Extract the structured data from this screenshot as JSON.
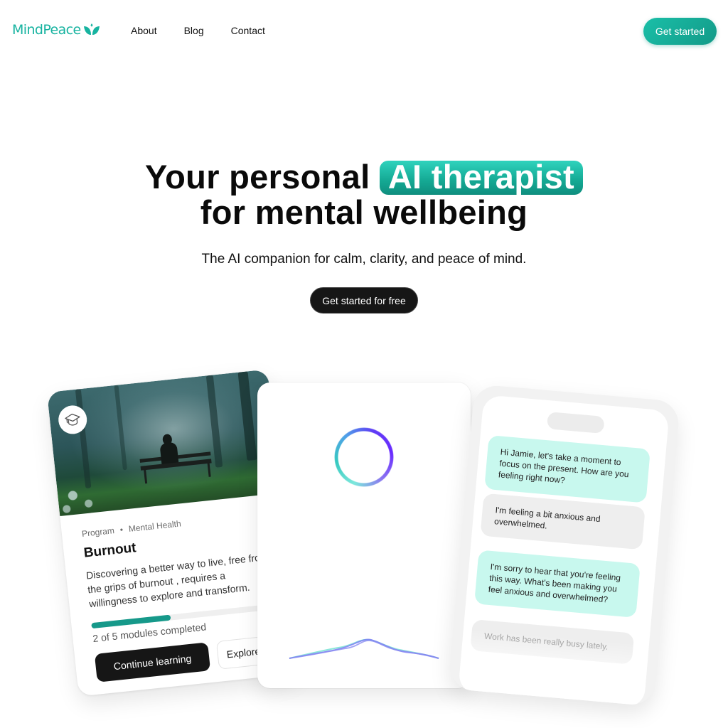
{
  "nav": {
    "logo_text": "MindPeace",
    "logo_icon": "leaf-sprout-icon",
    "links": [
      {
        "label": "About"
      },
      {
        "label": "Blog"
      },
      {
        "label": "Contact"
      }
    ],
    "cta_label": "Get started"
  },
  "hero": {
    "title_part1": "Your personal",
    "title_highlight": "AI therapist",
    "title_line2": "for mental wellbeing",
    "subtitle": "The AI companion for calm, clarity, and peace of mind.",
    "cta_label": "Get started for free"
  },
  "program_card": {
    "icon": "graduation-cap-icon",
    "type": "Program",
    "separator": "•",
    "category": "Mental Health",
    "title": "Burnout",
    "description": "Discovering a better way to live, free from the grips of burnout , requires a willingness to explore and transform.",
    "progress": {
      "completed": 2,
      "total": 5,
      "label": "2 of 5 modules completed"
    },
    "primary_button": "Continue learning",
    "secondary_button": "Explore"
  },
  "voice_card": {
    "orb": "voice-orb",
    "waveform": "audio-waveform"
  },
  "chat_card": {
    "messages": [
      {
        "role": "ai",
        "text": "Hi Jamie, let's take a moment to focus on the present. How are you feeling right now?"
      },
      {
        "role": "user",
        "text": "I'm feeling a bit anxious and overwhelmed."
      },
      {
        "role": "ai",
        "text": "I'm sorry to hear that you're feeling this way. What's been making you feel anxious and overwhelmed?"
      },
      {
        "role": "user",
        "text": "Work has been really busy lately."
      }
    ]
  },
  "colors": {
    "brand": "#17b3a0",
    "brand_dark": "#139a88",
    "progress": "#16998a",
    "ai_bubble": "#c8f8ee",
    "user_bubble": "#eeeeee",
    "dark_button": "#161616"
  }
}
